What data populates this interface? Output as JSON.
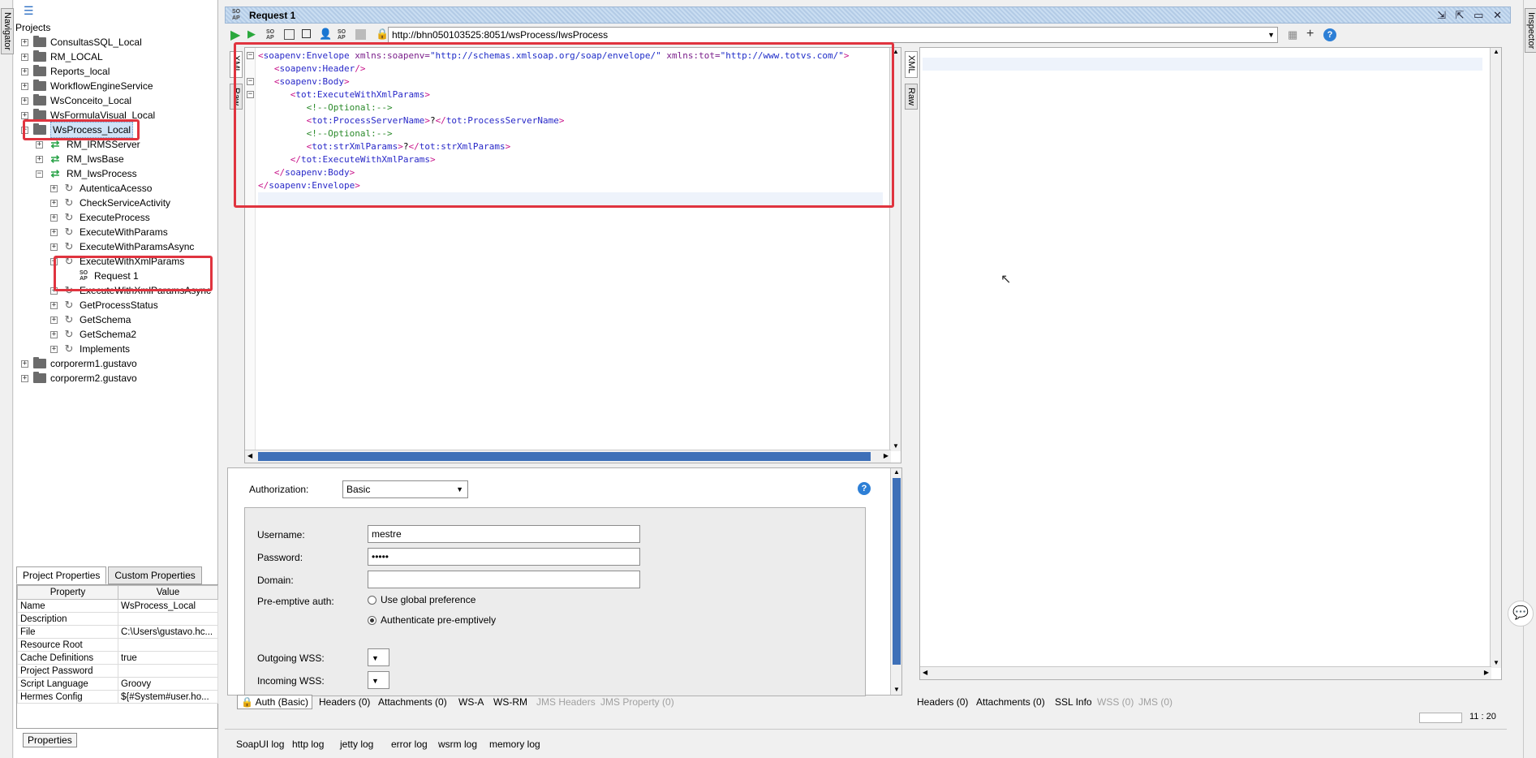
{
  "side": {
    "navigator_label": "Navigator",
    "inspector_label": "Inspector"
  },
  "navigator": {
    "root_label": "Projects",
    "tree": [
      {
        "label": "ConsultasSQL_Local",
        "kind": "project",
        "level": 0,
        "expander": "+"
      },
      {
        "label": "RM_LOCAL",
        "kind": "project",
        "level": 0,
        "expander": "+"
      },
      {
        "label": "Reports_local",
        "kind": "project",
        "level": 0,
        "expander": "+"
      },
      {
        "label": "WorkflowEngineService",
        "kind": "project",
        "level": 0,
        "expander": "+"
      },
      {
        "label": "WsConceito_Local",
        "kind": "project",
        "level": 0,
        "expander": "+"
      },
      {
        "label": "WsFormulaVisual_Local",
        "kind": "project",
        "level": 0,
        "expander": "+"
      },
      {
        "label": "WsProcess_Local",
        "kind": "project",
        "level": 0,
        "expander": "−",
        "selected": true
      },
      {
        "label": "RM_IRMSServer",
        "kind": "interface",
        "level": 1,
        "expander": "+"
      },
      {
        "label": "RM_IwsBase",
        "kind": "interface",
        "level": 1,
        "expander": "+"
      },
      {
        "label": "RM_IwsProcess",
        "kind": "interface",
        "level": 1,
        "expander": "−"
      },
      {
        "label": "AutenticaAcesso",
        "kind": "operation",
        "level": 2,
        "expander": "+"
      },
      {
        "label": "CheckServiceActivity",
        "kind": "operation",
        "level": 2,
        "expander": "+"
      },
      {
        "label": "ExecuteProcess",
        "kind": "operation",
        "level": 2,
        "expander": "+"
      },
      {
        "label": "ExecuteWithParams",
        "kind": "operation",
        "level": 2,
        "expander": "+"
      },
      {
        "label": "ExecuteWithParamsAsync",
        "kind": "operation",
        "level": 2,
        "expander": "+"
      },
      {
        "label": "ExecuteWithXmlParams",
        "kind": "operation",
        "level": 2,
        "expander": "−"
      },
      {
        "label": "Request 1",
        "kind": "request",
        "level": 3,
        "expander": ""
      },
      {
        "label": "ExecuteWithXmlParamsAsync",
        "kind": "operation",
        "level": 2,
        "expander": "+"
      },
      {
        "label": "GetProcessStatus",
        "kind": "operation",
        "level": 2,
        "expander": "+"
      },
      {
        "label": "GetSchema",
        "kind": "operation",
        "level": 2,
        "expander": "+"
      },
      {
        "label": "GetSchema2",
        "kind": "operation",
        "level": 2,
        "expander": "+"
      },
      {
        "label": "Implements",
        "kind": "operation",
        "level": 2,
        "expander": "+"
      },
      {
        "label": "corporerm1.gustavo",
        "kind": "project",
        "level": 0,
        "expander": "+"
      },
      {
        "label": "corporerm2.gustavo",
        "kind": "project",
        "level": 0,
        "expander": "+"
      }
    ]
  },
  "properties": {
    "tabs": [
      "Project Properties",
      "Custom Properties"
    ],
    "headers": [
      "Property",
      "Value"
    ],
    "rows": [
      [
        "Name",
        "WsProcess_Local"
      ],
      [
        "Description",
        ""
      ],
      [
        "File",
        "C:\\Users\\gustavo.hc..."
      ],
      [
        "Resource Root",
        ""
      ],
      [
        "Cache Definitions",
        "true"
      ],
      [
        "Project Password",
        ""
      ],
      [
        "Script Language",
        "Groovy"
      ],
      [
        "Hermes Config",
        "${#System#user.ho..."
      ]
    ],
    "button_label": "Properties"
  },
  "request": {
    "title": "Request 1",
    "soap_icon_text": "SO AP",
    "url": "http://bhn050103525:8051/wsProcess/IwsProcess",
    "left_tabs": [
      "XML",
      "Raw"
    ],
    "right_tabs": [
      "XML",
      "Raw"
    ],
    "xml_lines": [
      [
        {
          "c": "brk",
          "t": "<"
        },
        {
          "c": "tag",
          "t": "soapenv:Envelope "
        },
        {
          "c": "attr",
          "t": "xmlns:soapenv="
        },
        {
          "c": "str",
          "t": "\"http://schemas.xmlsoap.org/soap/envelope/\" "
        },
        {
          "c": "attr",
          "t": "xmlns:tot="
        },
        {
          "c": "str",
          "t": "\"http://www.totvs.com/\""
        },
        {
          "c": "brk",
          "t": ">"
        }
      ],
      [
        {
          "c": "txt",
          "t": "   "
        },
        {
          "c": "brk",
          "t": "<"
        },
        {
          "c": "tag",
          "t": "soapenv:Header"
        },
        {
          "c": "brk",
          "t": "/>"
        }
      ],
      [
        {
          "c": "txt",
          "t": "   "
        },
        {
          "c": "brk",
          "t": "<"
        },
        {
          "c": "tag",
          "t": "soapenv:Body"
        },
        {
          "c": "brk",
          "t": ">"
        }
      ],
      [
        {
          "c": "txt",
          "t": "      "
        },
        {
          "c": "brk",
          "t": "<"
        },
        {
          "c": "tag",
          "t": "tot:ExecuteWithXmlParams"
        },
        {
          "c": "brk",
          "t": ">"
        }
      ],
      [
        {
          "c": "txt",
          "t": "         "
        },
        {
          "c": "cmt",
          "t": "<!--Optional:-->"
        }
      ],
      [
        {
          "c": "txt",
          "t": "         "
        },
        {
          "c": "brk",
          "t": "<"
        },
        {
          "c": "tag",
          "t": "tot:ProcessServerName"
        },
        {
          "c": "brk",
          "t": ">"
        },
        {
          "c": "txt",
          "t": "?"
        },
        {
          "c": "brk",
          "t": "</"
        },
        {
          "c": "tag",
          "t": "tot:ProcessServerName"
        },
        {
          "c": "brk",
          "t": ">"
        }
      ],
      [
        {
          "c": "txt",
          "t": "         "
        },
        {
          "c": "cmt",
          "t": "<!--Optional:-->"
        }
      ],
      [
        {
          "c": "txt",
          "t": "         "
        },
        {
          "c": "brk",
          "t": "<"
        },
        {
          "c": "tag",
          "t": "tot:strXmlParams"
        },
        {
          "c": "brk",
          "t": ">"
        },
        {
          "c": "txt",
          "t": "?"
        },
        {
          "c": "brk",
          "t": "</"
        },
        {
          "c": "tag",
          "t": "tot:strXmlParams"
        },
        {
          "c": "brk",
          "t": ">"
        }
      ],
      [
        {
          "c": "txt",
          "t": "      "
        },
        {
          "c": "brk",
          "t": "</"
        },
        {
          "c": "tag",
          "t": "tot:ExecuteWithXmlParams"
        },
        {
          "c": "brk",
          "t": ">"
        }
      ],
      [
        {
          "c": "txt",
          "t": "   "
        },
        {
          "c": "brk",
          "t": "</"
        },
        {
          "c": "tag",
          "t": "soapenv:Body"
        },
        {
          "c": "brk",
          "t": ">"
        }
      ],
      [
        {
          "c": "brk",
          "t": "</"
        },
        {
          "c": "tag",
          "t": "soapenv:Envelope"
        },
        {
          "c": "brk",
          "t": ">"
        }
      ]
    ]
  },
  "auth": {
    "authorization_label": "Authorization:",
    "authorization_value": "Basic",
    "username_label": "Username:",
    "username_value": "mestre",
    "password_label": "Password:",
    "password_value": "•••••",
    "domain_label": "Domain:",
    "domain_value": "",
    "preemptive_label": "Pre-emptive auth:",
    "radio_global": "Use global preference",
    "radio_preemptive": "Authenticate pre-emptively",
    "outgoing_label": "Outgoing WSS:",
    "incoming_label": "Incoming WSS:"
  },
  "request_bottom_tabs": {
    "auth": "Auth (Basic)",
    "headers": "Headers (0)",
    "attachments": "Attachments (0)",
    "wsa": "WS-A",
    "wsrm": "WS-RM",
    "jms_headers": "JMS Headers",
    "jms_property": "JMS Property (0)"
  },
  "response_bottom_tabs": {
    "headers": "Headers (0)",
    "attachments": "Attachments (0)",
    "ssl": "SSL Info",
    "wss": "WSS (0)",
    "jms": "JMS (0)"
  },
  "status": {
    "position": "11 : 20"
  },
  "logs": [
    "SoapUI log",
    "http log",
    "jetty log",
    "error log",
    "wsrm log",
    "memory log"
  ],
  "colors": {
    "highlight": "#e0343f",
    "selection": "#cfe3f7"
  }
}
